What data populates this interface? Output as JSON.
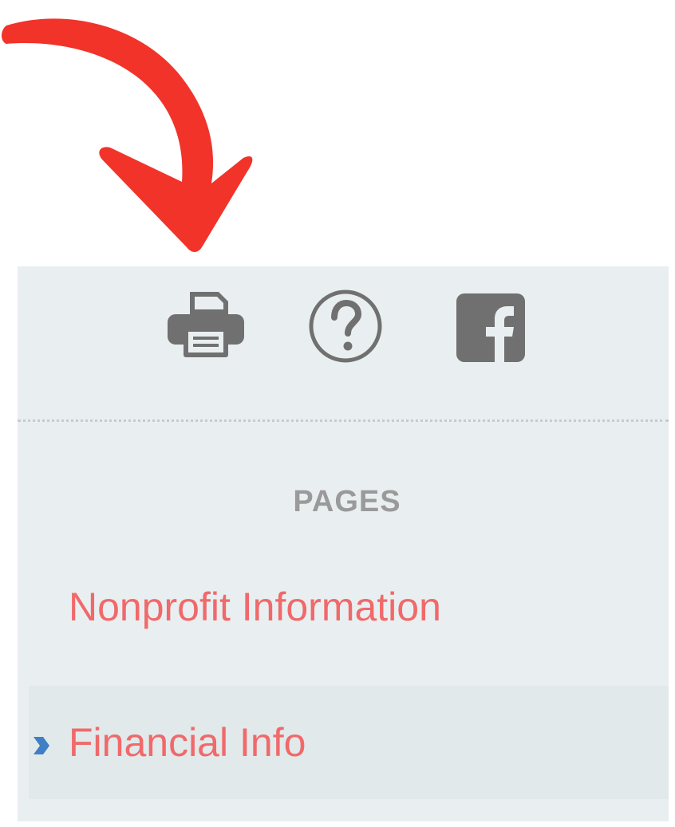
{
  "toolbar": {
    "icons": [
      "printer-icon",
      "help-icon",
      "facebook-icon"
    ]
  },
  "pages_heading": "PAGES",
  "nav": {
    "items": [
      {
        "label": "Nonprofit Information",
        "active": false
      },
      {
        "label": "Financial Info",
        "active": true
      }
    ]
  },
  "colors": {
    "arrow": "#f1332a",
    "panel_bg": "#e9eff0",
    "active_row_bg": "#e2e9ea",
    "link": "#f0696b",
    "heading": "#9a9a9a",
    "icon": "#707070",
    "marker": "#3f7fc4"
  }
}
